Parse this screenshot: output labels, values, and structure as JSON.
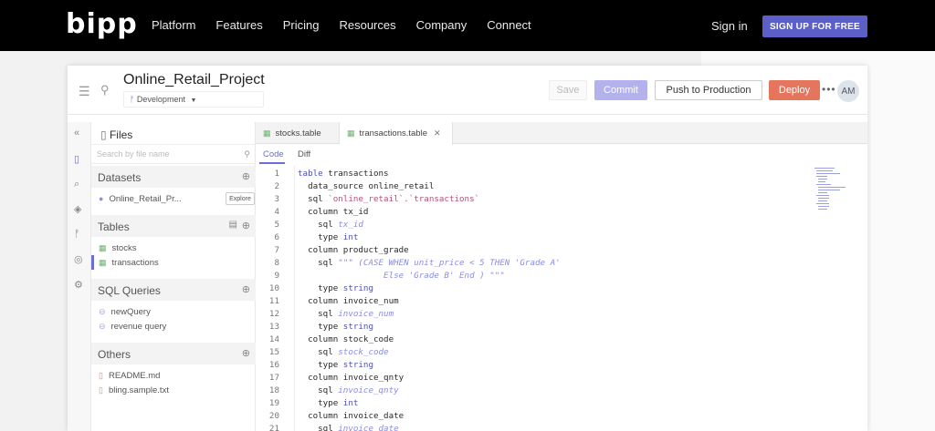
{
  "nav": {
    "logo": "bipp",
    "links": [
      "Platform",
      "Features",
      "Pricing",
      "Resources",
      "Company",
      "Connect"
    ],
    "signin": "Sign in",
    "signup": "SIGN UP FOR FREE"
  },
  "app": {
    "title": "Online_Retail_Project",
    "branch": "Development",
    "buttons": {
      "save": "Save",
      "commit": "Commit",
      "push": "Push to Production",
      "deploy": "Deploy"
    },
    "avatar": "AM"
  },
  "files": {
    "header": "Files",
    "search_placeholder": "Search by file name",
    "sections": {
      "datasets": "Datasets",
      "tables": "Tables",
      "queries": "SQL Queries",
      "others": "Others"
    },
    "dataset_item": "Online_Retail_Pr...",
    "explore": "Explore",
    "tables": [
      "stocks",
      "transactions"
    ],
    "queries": [
      "newQuery",
      "revenue query"
    ],
    "others": [
      "README.md",
      "bling.sample.txt"
    ]
  },
  "editor": {
    "tabs": [
      "stocks.table",
      "transactions.table"
    ],
    "subtabs": [
      "Code",
      "Diff"
    ],
    "lines": [
      "1",
      "2",
      "3",
      "4",
      "5",
      "6",
      "7",
      "8",
      "9",
      "10",
      "11",
      "12",
      "13",
      "14",
      "15",
      "16",
      "17",
      "18",
      "19",
      "20",
      "21"
    ],
    "code": {
      "l1a": "table",
      "l1b": " transactions",
      "l2": "  data_source online_retail",
      "l3a": "  sql ",
      "l3b": "`online_retail`.`transactions`",
      "l4": "  column tx_id",
      "l5a": "    sql ",
      "l5b": "tx_id",
      "l6a": "    type ",
      "l6b": "int",
      "l7": "  column product_grade",
      "l8a": "    sql ",
      "l8b": "\"\"\" (CASE WHEN unit_price < 5 THEN 'Grade A'",
      "l9": "                 Else 'Grade B' End ) \"\"\"",
      "l10a": "    type ",
      "l10b": "string",
      "l11": "  column invoice_num",
      "l12a": "    sql ",
      "l12b": "invoice_num",
      "l13a": "    type ",
      "l13b": "string",
      "l14": "  column stock_code",
      "l15a": "    sql ",
      "l15b": "stock_code",
      "l16a": "    type ",
      "l16b": "string",
      "l17": "  column invoice_qnty",
      "l18a": "    sql ",
      "l18b": "invoice_qnty",
      "l19a": "    type ",
      "l19b": "int",
      "l20": "  column invoice_date",
      "l21a": "    sql ",
      "l21b": "invoice_date"
    }
  },
  "colors": {
    "accent": "#5b5fc7",
    "deploy": "#e5765d",
    "commit": "#b4b2ec"
  }
}
